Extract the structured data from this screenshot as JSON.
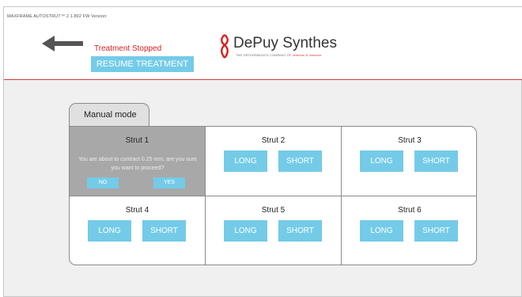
{
  "header": {
    "version_text": "MAXFRAME AUTOSTRUT™ 2.1.892 FW Version:",
    "status": "Treatment Stopped",
    "resume_label": "RESUME TREATMENT",
    "logo": {
      "brand": "DePuy Synthes",
      "tagline_prefix": "THE ORTHOPAEDICS COMPANY OF",
      "tagline_brand": "Johnson & Johnson"
    }
  },
  "mode_tab": "Manual mode",
  "struts": [
    {
      "label": "Strut 1",
      "confirm": {
        "message": "You are about to contract 0.25 mm, are you sure you want to proceed?",
        "no_label": "NO",
        "yes_label": "YES"
      }
    },
    {
      "label": "Strut 2",
      "long_label": "LONG",
      "short_label": "SHORT"
    },
    {
      "label": "Strut 3",
      "long_label": "LONG",
      "short_label": "SHORT"
    },
    {
      "label": "Strut 4",
      "long_label": "LONG",
      "short_label": "SHORT"
    },
    {
      "label": "Strut 5",
      "long_label": "LONG",
      "short_label": "SHORT"
    },
    {
      "label": "Strut 6",
      "long_label": "LONG",
      "short_label": "SHORT"
    }
  ],
  "colors": {
    "accent": "#74cbe8",
    "status_red": "#d81e1e",
    "divider_red": "#d83a3a",
    "active_cell": "#a8a8a8"
  },
  "icons": {
    "back": "left-arrow-icon",
    "logo_mark": "depuy-synthes-logo-icon"
  }
}
